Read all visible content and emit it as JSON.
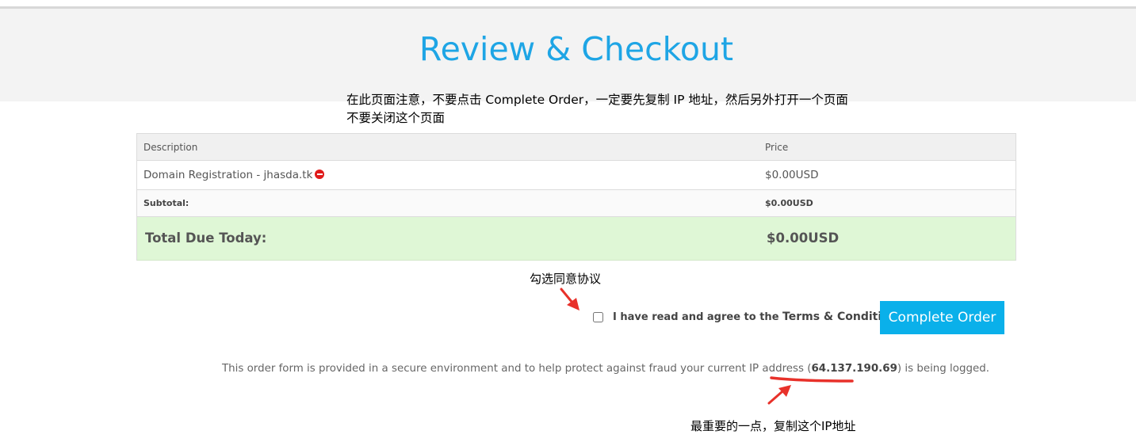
{
  "header": {
    "title": "Review & Checkout"
  },
  "annotations": {
    "note_line1": "在此页面注意，不要点击 Complete Order，一定要先复制 IP 地址，然后另外打开一个页面",
    "note_line2": "不要关闭这个页面",
    "agree_hint": "勾选同意协议",
    "ip_hint": "最重要的一点，复制这个IP地址",
    "arrow_color": "#e8312a"
  },
  "cart": {
    "columns": {
      "description": "Description",
      "price": "Price"
    },
    "item": {
      "description": "Domain Registration - jhasda.tk",
      "price": "$0.00USD"
    },
    "subtotal": {
      "label": "Subtotal:",
      "value": "$0.00USD"
    },
    "total": {
      "label": "Total Due Today:",
      "value": "$0.00USD"
    },
    "total_bg_color": "#dff7d6"
  },
  "agree": {
    "prefix": "I have read and agree to the ",
    "link": "Terms & Conditions",
    "checked": false
  },
  "actions": {
    "complete_label": "Complete Order",
    "button_color": "#0ab0ea"
  },
  "security": {
    "before": "This order form is provided in a secure environment and to help protect against fraud your current IP address (",
    "ip": "64.137.190.69",
    "after": ") is being logged."
  },
  "icons": {
    "remove": "remove-circle-icon",
    "checkbox": "checkbox-icon"
  }
}
